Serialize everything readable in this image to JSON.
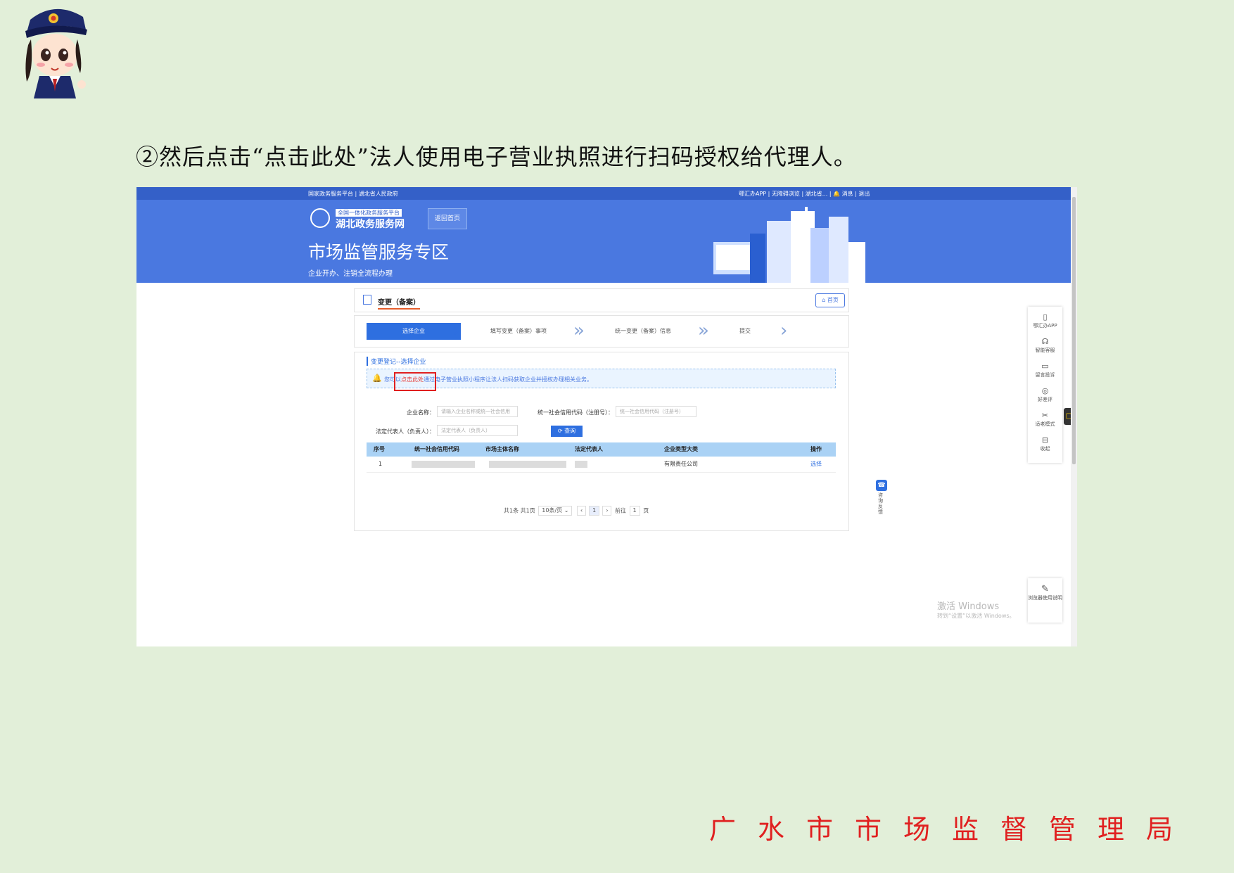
{
  "instruction": "②然后点击“点击此处”法人使用电子营业执照进行扫码授权给代理人。",
  "footer": "广水市市场监督管理局",
  "screenshot": {
    "topbar": {
      "left": "国家政务服务平台 | 湖北省人民政府",
      "right": "鄂汇办APP | 无障碍浏览 | 湖北省... | 🔔 消息 | 退出"
    },
    "banner": {
      "logo_small": "全国一体化政务服务平台",
      "logo_big": "湖北政务服务网",
      "switch_button": "返回首页",
      "zone_title": "市场监管服务专区",
      "zone_subtitle": "企业开办、注销全流程办理"
    },
    "tab_label": "变更（备案）",
    "home_button": "首页",
    "steps": [
      "选择企业",
      "填写变更（备案）事项",
      "统一变更（备案）信息",
      "提交"
    ],
    "section_title": "变更登记--选择企业",
    "notice": {
      "prefix": "您可以",
      "link": "点击此处",
      "suffix": "通过电子营业执照小程序让法人扫码获取企业并授权办理相关业务。"
    },
    "form": {
      "company_name_label": "企业名称：",
      "company_name_placeholder": "请输入企业名称或统一社会信用",
      "credit_code_label": "统一社会信用代码（注册号）：",
      "credit_code_placeholder": "统一社会信用代码（注册号）",
      "legal_rep_label": "法定代表人（负责人）：",
      "legal_rep_placeholder": "法定代表人（负责人）",
      "query_button": "查询"
    },
    "table": {
      "headers": [
        "序号",
        "统一社会信用代码",
        "市场主体名称",
        "法定代表人",
        "企业类型大类",
        "操作"
      ],
      "rows": [
        {
          "index": "1",
          "type": "有限责任公司",
          "action": "选择"
        }
      ]
    },
    "pager": {
      "summary": "共1条 共1页",
      "page_size": "10条/页",
      "current": "1",
      "goto_label": "前往",
      "goto_value": "1",
      "page_unit": "页"
    },
    "right_panel": [
      {
        "icon": "phone-icon",
        "label": "鄂汇办APP"
      },
      {
        "icon": "headset-icon",
        "label": "智能客服"
      },
      {
        "icon": "message-icon",
        "label": "留言投诉"
      },
      {
        "icon": "coin-icon",
        "label": "好差评"
      },
      {
        "icon": "scissor-icon",
        "label": "适老模式"
      },
      {
        "icon": "minus-icon",
        "label": "收起"
      }
    ],
    "side_tab": "咨询反馈",
    "browser_panel": "浏览器使用说明",
    "watermark_line1": "激活 Windows",
    "watermark_line2": "转到“设置”以激活 Windows。"
  }
}
